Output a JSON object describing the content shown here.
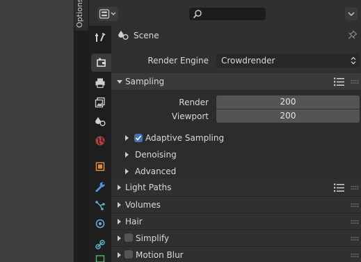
{
  "sidebar": {
    "options_label": "Options"
  },
  "header": {
    "search_placeholder": ""
  },
  "scene": {
    "label": "Scene"
  },
  "render_engine": {
    "label": "Render Engine",
    "value": "Crowdrender"
  },
  "sampling": {
    "title": "Sampling",
    "render_label": "Render",
    "render_value": "200",
    "viewport_label": "Viewport",
    "viewport_value": "200",
    "adaptive_label": "Adaptive Sampling",
    "adaptive_checked": true,
    "denoising_label": "Denoising",
    "advanced_label": "Advanced"
  },
  "panels": {
    "light_paths": "Light Paths",
    "volumes": "Volumes",
    "hair": "Hair",
    "simplify": "Simplify",
    "motion_blur": "Motion Blur"
  },
  "tabs": [
    "tool-tab",
    "render-tab",
    "output-tab",
    "view-layer-tab",
    "scene-tab",
    "world-tab",
    "object-tab",
    "modifiers-tab",
    "particles-tab",
    "physics-tab",
    "constraints-tab",
    "data-tab"
  ],
  "colors": {
    "accent": "#4772b3",
    "panel": "#303030",
    "header_band": "#3a3a3a",
    "field": "#545454"
  }
}
